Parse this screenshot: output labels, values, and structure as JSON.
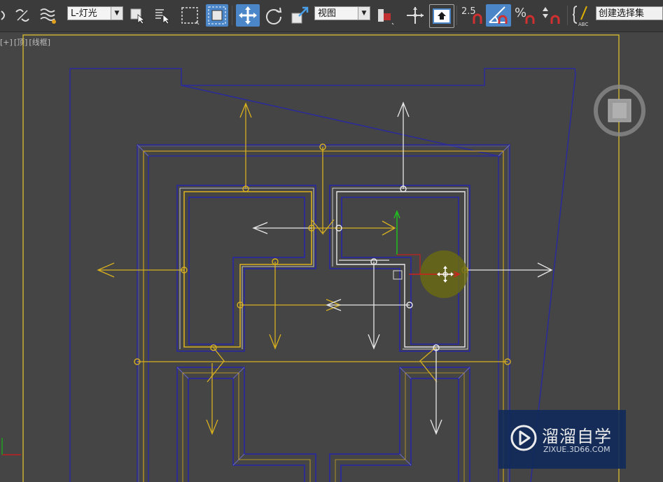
{
  "toolbar": {
    "layer_dropdown": "L-灯光",
    "reference_dropdown": "视图",
    "snap_angle_label": "2.5",
    "selection_set": "创建选择集"
  },
  "viewport": {
    "label_plus": "[+]",
    "label_view": "[顶]",
    "label_shading": "[线框]"
  },
  "watermark": {
    "title": "溜溜自学",
    "subtitle": "ZIXUE.3D66.COM"
  }
}
